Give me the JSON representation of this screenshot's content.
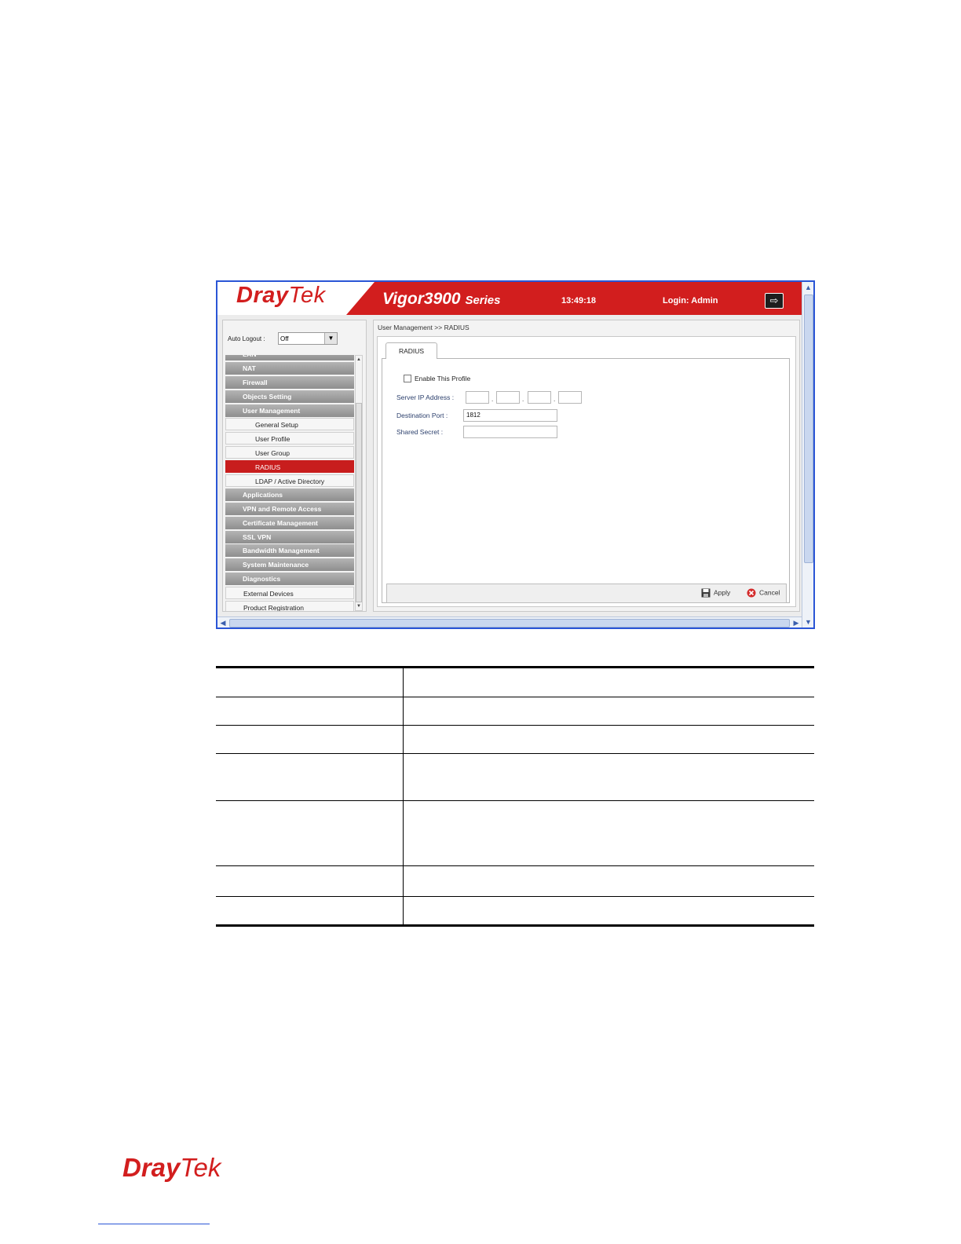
{
  "header": {
    "logo_dray": "Dray",
    "logo_tek": "Tek",
    "model": "Vigor3900",
    "series": "Series",
    "time": "13:49:18",
    "login": "Login: Admin"
  },
  "sidebar": {
    "auto_logout_label": "Auto Logout :",
    "auto_logout_value": "Off",
    "items": [
      {
        "label": "LAN",
        "kind": "group"
      },
      {
        "label": "NAT",
        "kind": "group"
      },
      {
        "label": "Firewall",
        "kind": "group"
      },
      {
        "label": "Objects Setting",
        "kind": "group"
      },
      {
        "label": "User Management",
        "kind": "group"
      },
      {
        "label": "General Setup",
        "kind": "sub"
      },
      {
        "label": "User Profile",
        "kind": "sub"
      },
      {
        "label": "User Group",
        "kind": "sub"
      },
      {
        "label": "RADIUS",
        "kind": "sub-active"
      },
      {
        "label": "LDAP / Active Directory",
        "kind": "sub"
      },
      {
        "label": "Applications",
        "kind": "group"
      },
      {
        "label": "VPN and Remote Access",
        "kind": "group"
      },
      {
        "label": "Certificate Management",
        "kind": "group"
      },
      {
        "label": "SSL VPN",
        "kind": "group"
      },
      {
        "label": "Bandwidth Management",
        "kind": "group"
      },
      {
        "label": "System Maintenance",
        "kind": "group"
      },
      {
        "label": "Diagnostics",
        "kind": "group"
      },
      {
        "label": "External Devices",
        "kind": "plain"
      },
      {
        "label": "Product Registration",
        "kind": "plain"
      }
    ]
  },
  "content": {
    "breadcrumb": "User Management >> RADIUS",
    "tab": "RADIUS",
    "enable_label": "Enable This Profile",
    "server_ip_label": "Server IP Address :",
    "server_ip": [
      "",
      "",
      "",
      ""
    ],
    "dest_port_label": "Destination Port :",
    "dest_port_value": "1812",
    "shared_secret_label": "Shared Secret :",
    "shared_secret_value": "",
    "apply": "Apply",
    "cancel": "Cancel"
  },
  "colors": {
    "brand_red": "#d21e1e",
    "active_menu": "#c81d1d",
    "frame_blue": "#2a55d6"
  },
  "footer": {
    "logo_dray": "Dray",
    "logo_tek": "Tek"
  }
}
